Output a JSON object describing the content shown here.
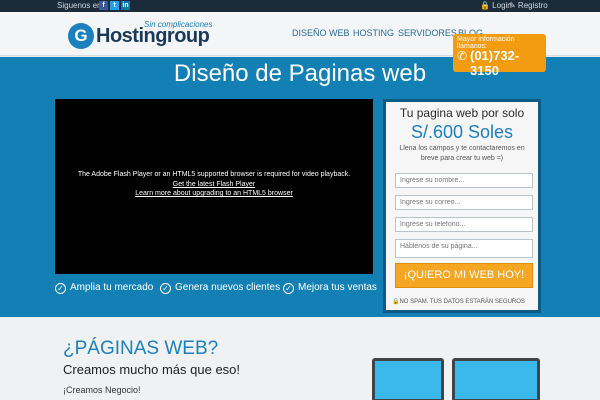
{
  "topbar": {
    "follow": "Siguenos en:",
    "social": [
      "f",
      "t",
      "in"
    ],
    "login": "🔒 Login",
    "register": "✎ Registro"
  },
  "header": {
    "logo_mark": "G",
    "logo_tagline": "Sin complicaciones",
    "logo_text": "Hostingroup",
    "nav": [
      "DISEÑO WEB",
      "HOSTING",
      "SERVIDORES",
      "BLOG"
    ],
    "phone_label": "Mayor información llámanos:",
    "phone_icon": "✆",
    "phone_number": "(01)732-3150"
  },
  "hero": {
    "title": "Diseño de Paginas web",
    "video_msg": "The Adobe Flash Player or an HTML5 supported browser is required for video playback.",
    "video_link_1": "Get the latest Flash Player",
    "video_link_2": "Learn more about upgrading to an HTML5 browser",
    "features": [
      "Amplia tu mercado",
      "Genera nuevos clientes",
      "Mejora tus ventas"
    ],
    "check_icon": "✓"
  },
  "form": {
    "title": "Tu pagina web por solo",
    "price": "S/.600 Soles",
    "subtitle": "Llena los campos y te contactaremos en breve para crear tu web =)",
    "placeholders": [
      "Ingrese su nombre...",
      "Ingrese su correo...",
      "Ingrese su telefono...",
      "Háblenos de su página..."
    ],
    "cta": "¡QUIERO MI WEB HOY!",
    "spam": "🔒NO SPAM. TUS DATOS ESTARÁN SEGUROS"
  },
  "lower": {
    "heading": "¿PÁGINAS WEB?",
    "subheading": "Creamos mucho más que eso!",
    "text": "¡Creamos Negocio!"
  },
  "colors": {
    "brand_blue": "#1380b5",
    "accent_orange": "#f5a623",
    "dark_bar": "#1b2b3a"
  }
}
